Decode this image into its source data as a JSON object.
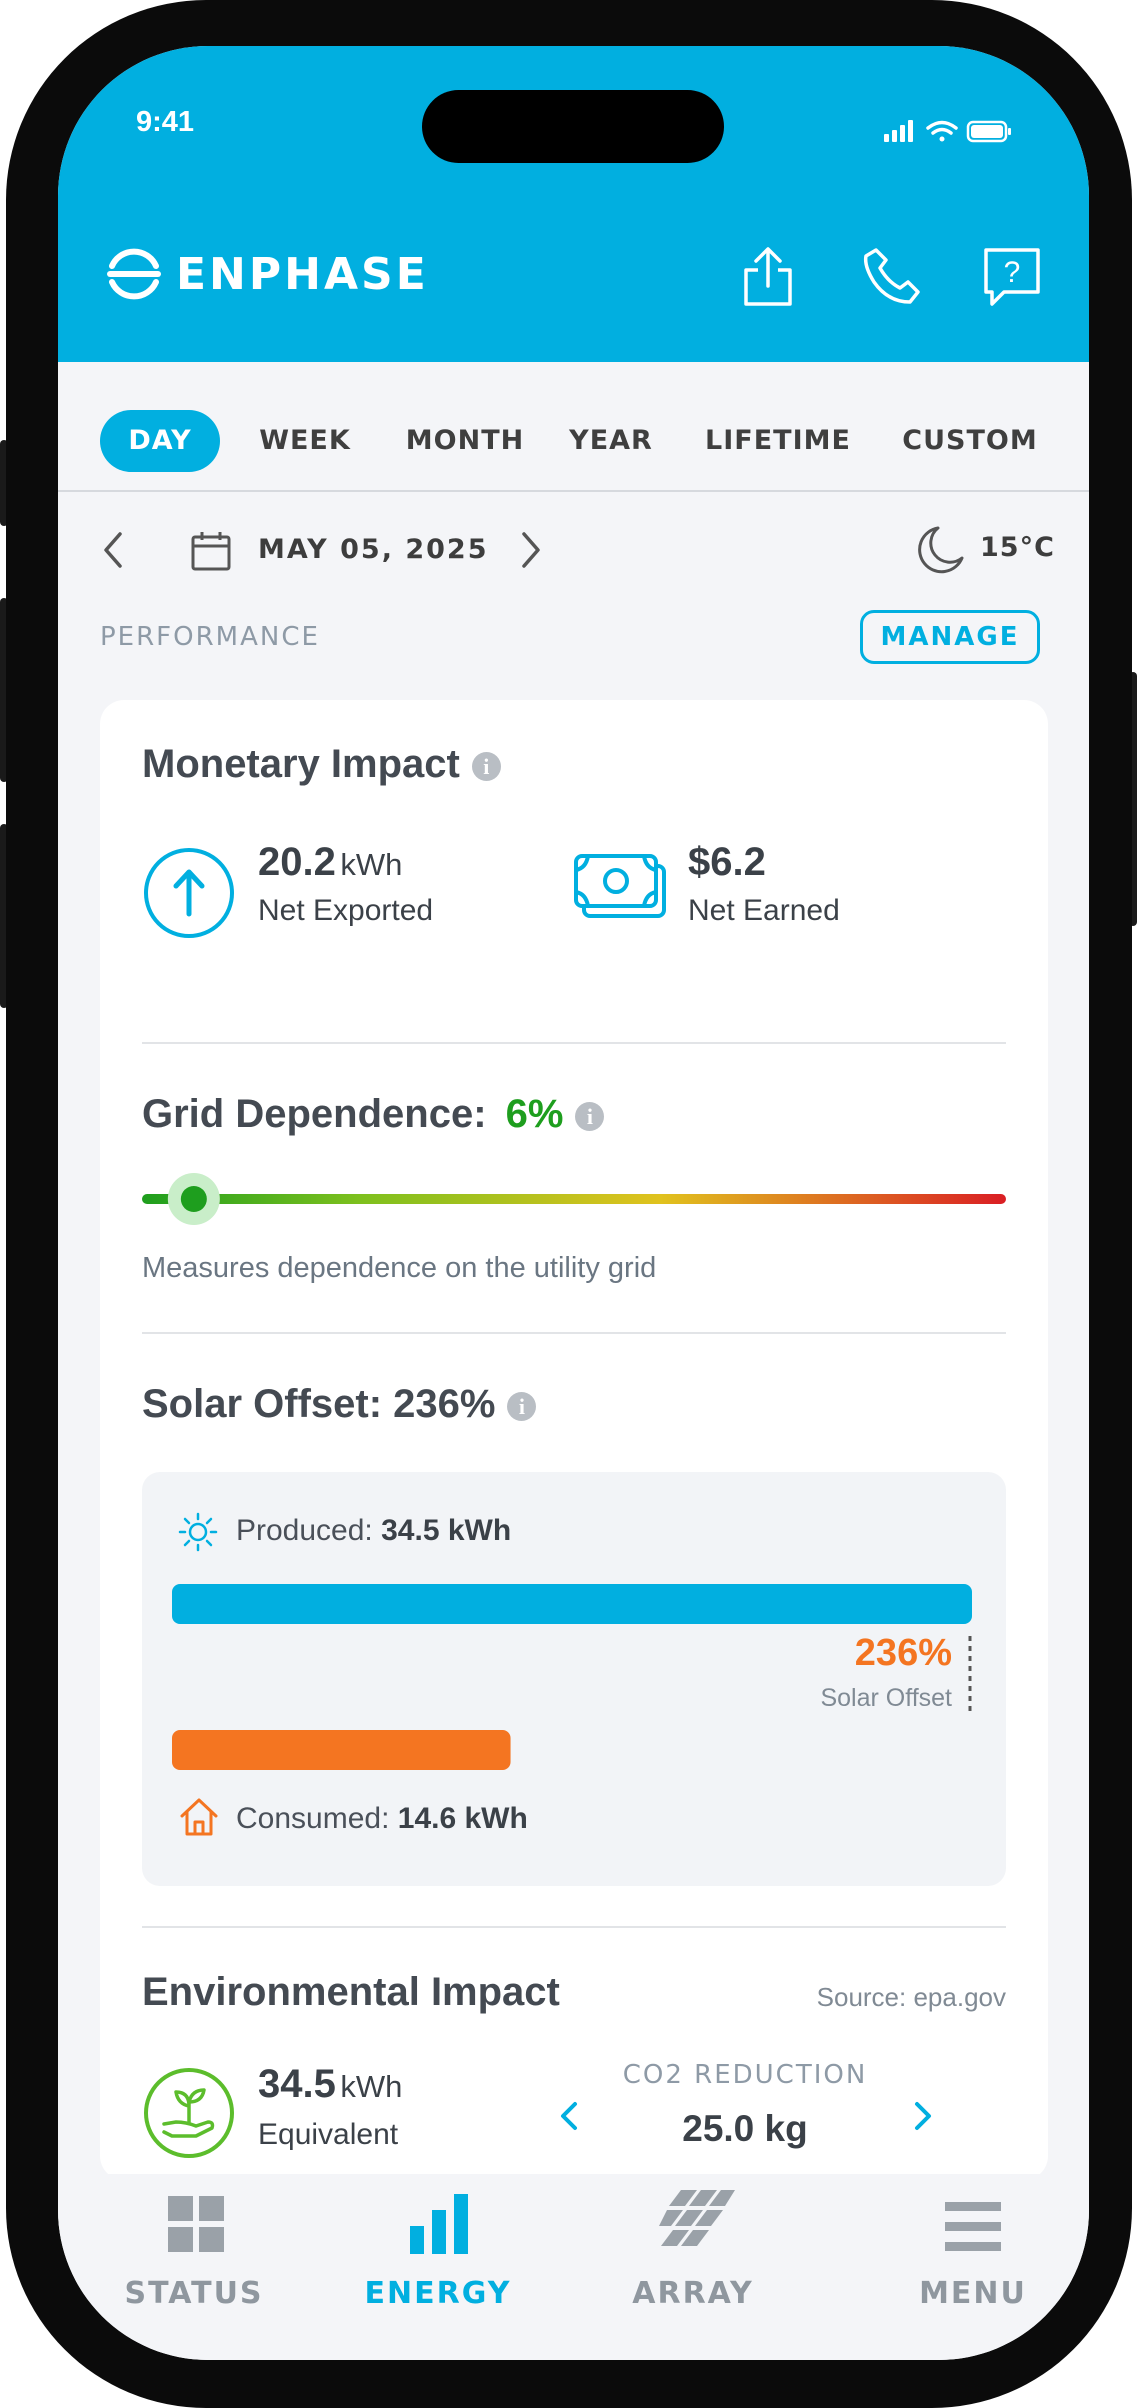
{
  "status_bar": {
    "time": "9:41"
  },
  "header": {
    "brand": "ENPHASE",
    "icons": [
      "share-icon",
      "phone-icon",
      "help-icon"
    ]
  },
  "tabs": [
    {
      "label": "DAY",
      "active": true
    },
    {
      "label": "WEEK",
      "active": false
    },
    {
      "label": "MONTH",
      "active": false
    },
    {
      "label": "YEAR",
      "active": false
    },
    {
      "label": "LIFETIME",
      "active": false
    },
    {
      "label": "CUSTOM",
      "active": false
    }
  ],
  "date_nav": {
    "date": "MAY 05, 2025",
    "weather": "15°C"
  },
  "performance": {
    "label": "PERFORMANCE",
    "manage_label": "MANAGE"
  },
  "monetary": {
    "title": "Monetary Impact",
    "exported_value": "20.2",
    "exported_unit": "kWh",
    "exported_label": "Net Exported",
    "earned_value": "$6.2",
    "earned_label": "Net Earned"
  },
  "grid": {
    "title": "Grid Dependence:",
    "percent": "6%",
    "level": 6,
    "description": "Measures dependence on the utility grid"
  },
  "solar": {
    "title": "Solar Offset: 236%",
    "produced_label": "Produced:",
    "produced_value": "34.5 kWh",
    "produced_kwh": 34.5,
    "offset_percent": "236%",
    "offset_label": "Solar Offset",
    "consumed_label": "Consumed:",
    "consumed_value": "14.6 kWh",
    "consumed_kwh": 14.6
  },
  "environmental": {
    "title": "Environmental Impact",
    "source": "Source: epa.gov",
    "value": "34.5",
    "unit": "kWh",
    "label": "Equivalent",
    "reduction_label": "CO2 REDUCTION",
    "reduction_value": "25.0 kg"
  },
  "bottom_nav": [
    {
      "label": "STATUS",
      "active": false
    },
    {
      "label": "ENERGY",
      "active": true
    },
    {
      "label": "ARRAY",
      "active": false
    },
    {
      "label": "MENU",
      "active": false
    }
  ],
  "colors": {
    "accent": "#01afe0",
    "good": "#1e9e1e",
    "consumed": "#f47521",
    "offset": "#f47521"
  }
}
